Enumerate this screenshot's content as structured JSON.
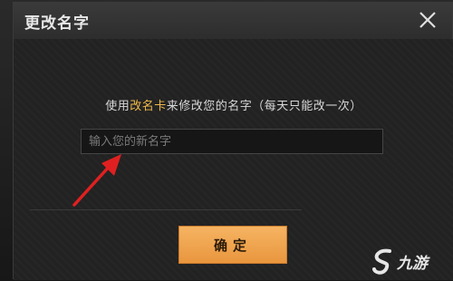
{
  "dialog": {
    "title": "更改名字",
    "close_icon": "close-icon",
    "instruction_prefix": "使用",
    "instruction_highlight": "改名卡",
    "instruction_suffix": "来修改您的名字（每天只能改一次）",
    "input_placeholder": "输入您的新名字",
    "input_value": "",
    "confirm_label": "确定"
  },
  "watermark": {
    "logo_icon": "jiuyou-logo-icon",
    "text": "九游"
  },
  "colors": {
    "highlight": "#f0b84a",
    "confirm_button": "#f0a855",
    "annotation_arrow": "#e02020"
  }
}
